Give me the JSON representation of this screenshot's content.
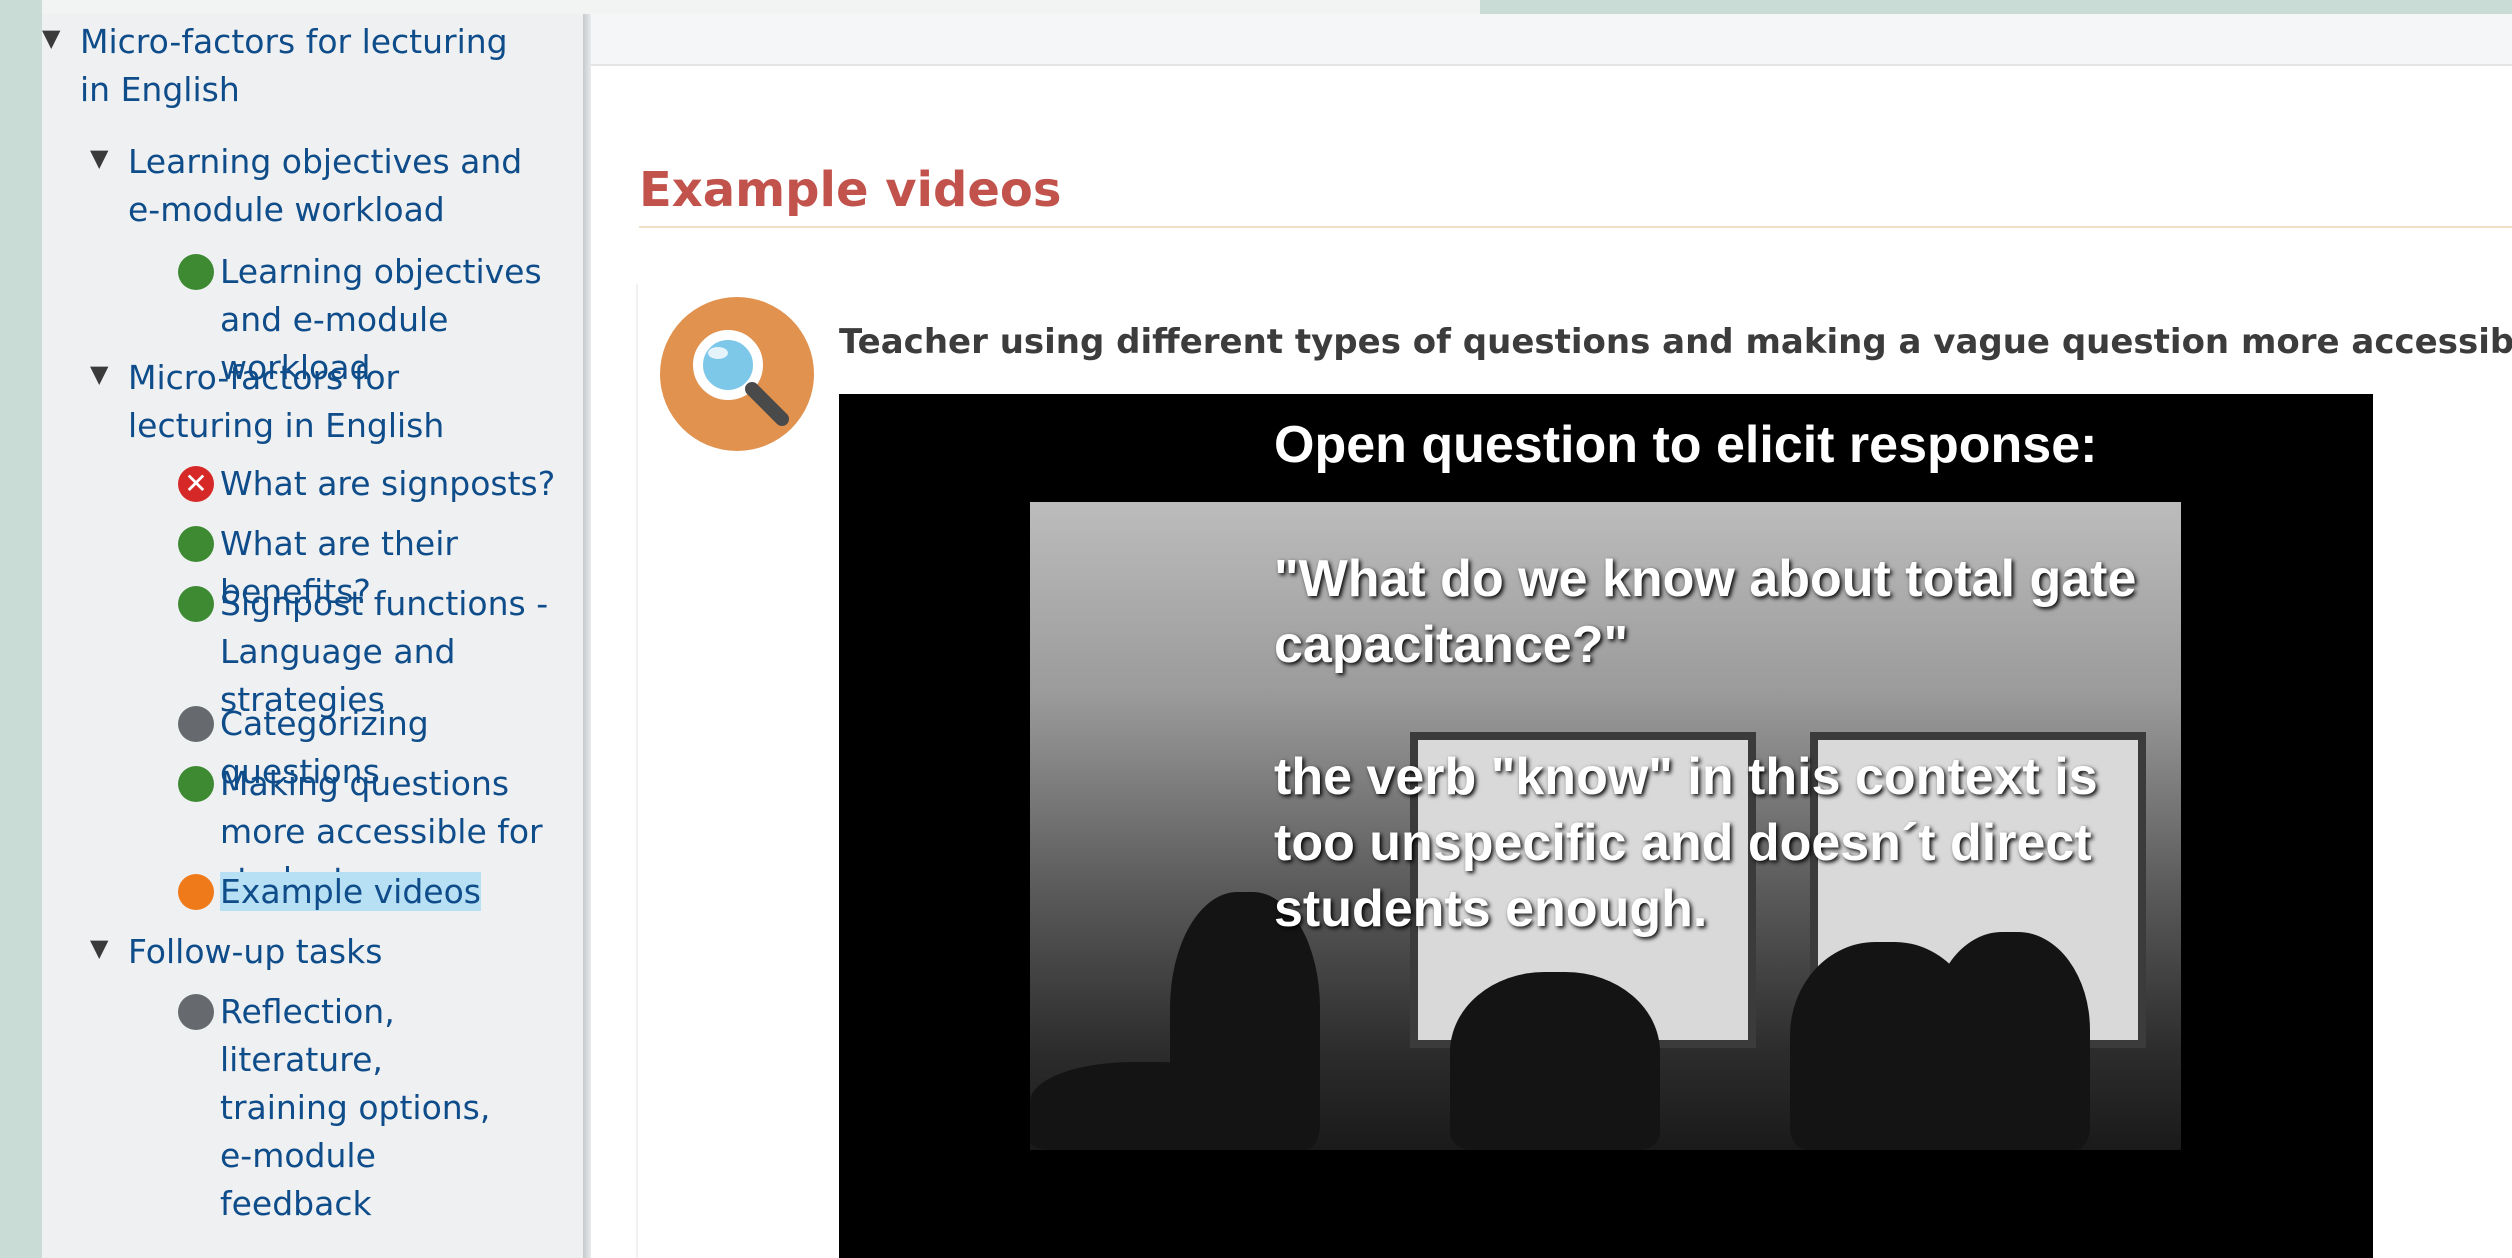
{
  "sidebar": {
    "tree": [
      {
        "label": "Micro-factors for lecturing in English",
        "type": "section",
        "expanded": true
      },
      {
        "label": "Learning objectives and e-module workload",
        "type": "section",
        "expanded": true
      },
      {
        "label": "Learning objectives and e-module workload",
        "type": "page",
        "status": "completed"
      },
      {
        "label": "Micro-factors for lecturing in English",
        "type": "section",
        "expanded": true
      },
      {
        "label": "What are signposts?",
        "type": "page",
        "status": "failed"
      },
      {
        "label": "What are their benefits?",
        "type": "page",
        "status": "completed"
      },
      {
        "label": "Signpost functions - Language and strategies",
        "type": "page",
        "status": "completed"
      },
      {
        "label": "Categorizing questions",
        "type": "page",
        "status": "not-attempted"
      },
      {
        "label": "Making questions more accessible for students",
        "type": "page",
        "status": "completed"
      },
      {
        "label": "Example videos",
        "type": "page",
        "status": "current"
      },
      {
        "label": "Follow-up tasks",
        "type": "section",
        "expanded": true
      },
      {
        "label": "Reflection, literature, training options, e-module feedback",
        "type": "page",
        "status": "not-attempted"
      }
    ],
    "toggle_glyph": "▼",
    "failed_glyph": "✕"
  },
  "main": {
    "section_title": "Example videos",
    "activity_icon": "magnifier-icon",
    "video_heading": "Teacher using different types of questions and making a vague question more accessible",
    "video": {
      "line1": "Open question to elicit response:",
      "line2a": "\"What do we know about total gate",
      "line2b": "capacitance?\"",
      "line3a": "the verb \"know\" in this context is",
      "line3b": "too unspecific and doesn´t direct",
      "line3c": "students enough."
    }
  },
  "colors": {
    "link": "#0f4c8a",
    "title": "#c1534c",
    "completed": "#3d8a32",
    "not_attempted": "#666a6e",
    "current": "#ef7a1a",
    "failed": "#d72828",
    "current_highlight": "#b8e0f4"
  }
}
